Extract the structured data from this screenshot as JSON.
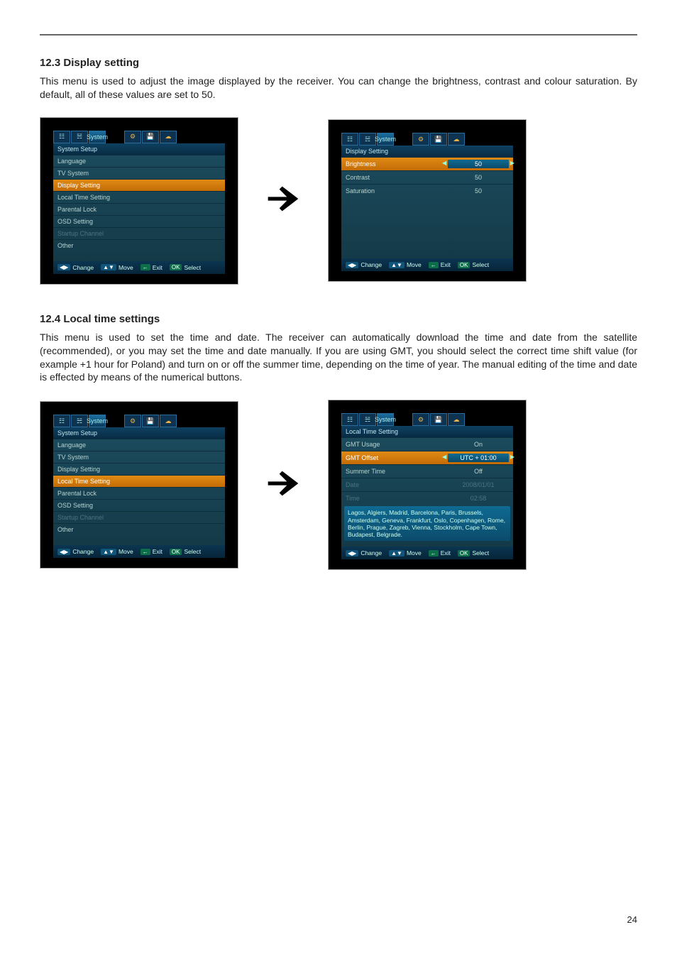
{
  "section_a": {
    "heading": "12.3 Display setting",
    "body": "This menu is used to adjust the image displayed by the receiver. You can change the brightness, contrast and colour saturation. By default, all of these values are set to 50."
  },
  "section_b": {
    "heading": "12.4 Local time settings",
    "body": "This menu is used to set the time and date. The receiver can automatically download the time and date from the satellite (recommended), or you may set the time and date manually. If you are using GMT, you should select the correct time shift value (for example +1 hour for Poland) and turn on or off the summer time, depending on the time of year. The manual editing of the time and date is effected by means of the numerical buttons."
  },
  "osd": {
    "tab_label": "System",
    "system_setup_title": "System Setup",
    "items": {
      "language": "Language",
      "tv_system": "TV System",
      "display_setting": "Display Setting",
      "local_time_setting": "Local Time Setting",
      "parental_lock": "Parental Lock",
      "osd_setting": "OSD Setting",
      "startup_channel": "Startup Channel",
      "other": "Other"
    },
    "display_setting": {
      "title": "Display Setting",
      "brightness_label": "Brightness",
      "brightness_value": "50",
      "contrast_label": "Contrast",
      "contrast_value": "50",
      "saturation_label": "Saturation",
      "saturation_value": "50"
    },
    "local_time": {
      "title": "Local Time Setting",
      "gmt_usage_label": "GMT Usage",
      "gmt_usage_value": "On",
      "gmt_offset_label": "GMT Offset",
      "gmt_offset_value": "UTC + 01:00",
      "summer_time_label": "Summer Time",
      "summer_time_value": "Off",
      "date_label": "Date",
      "date_value": "2008/01/01",
      "time_label": "Time",
      "time_value": "02:58",
      "hint": "Lagos, Algiers, Madrid, Barcelona, Paris, Brussels, Amsterdam, Geneva, Frankfurt, Oslo, Copenhagen, Rome, Berlin, Prague, Zagreb, Vienna, Stockholm, Cape Town, Budapest, Belgrade."
    },
    "footer": {
      "change": "Change",
      "move": "Move",
      "exit": "Exit",
      "select": "Select"
    }
  },
  "page_number": "24"
}
